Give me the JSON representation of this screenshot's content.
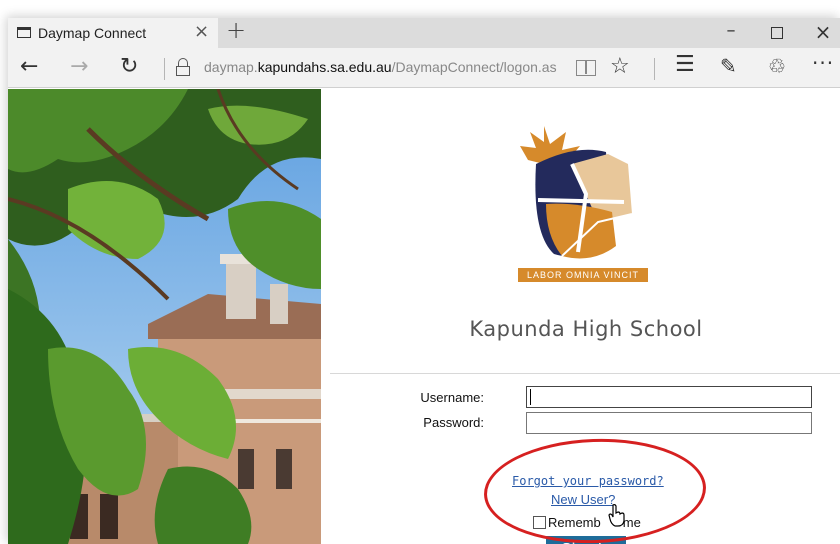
{
  "browser": {
    "tab_title": "Daymap Connect",
    "tab_close": "×",
    "new_tab": "+",
    "window_min": "–",
    "window_close": "×",
    "nav_back": "←",
    "nav_forward": "→",
    "nav_refresh": "↻",
    "url_prefix": "daymap.",
    "url_domain": "kapundahs.sa.edu.au",
    "url_path": "/DaymapConnect/logon.as",
    "favorite": "☆",
    "hub": "☰",
    "note": "✎",
    "share": "♲",
    "more": "···"
  },
  "page": {
    "motto": "LABOR OMNIA VINCIT",
    "school_name": "Kapunda High School",
    "username_label": "Username:",
    "password_label": "Password:",
    "username_value": "",
    "password_value": "",
    "forgot_link": "Forgot your password?",
    "new_user_link": "New User?",
    "remember_label": "Rememb",
    "remember_label_tail": "me",
    "sign_in": "Sign In"
  },
  "colors": {
    "sign_in_bg": "#1e6c9a",
    "link": "#2a5aa8",
    "highlight": "#d62020",
    "logo_navy": "#232a5c",
    "logo_orange": "#d68a2b",
    "logo_tan": "#e8c79a"
  }
}
